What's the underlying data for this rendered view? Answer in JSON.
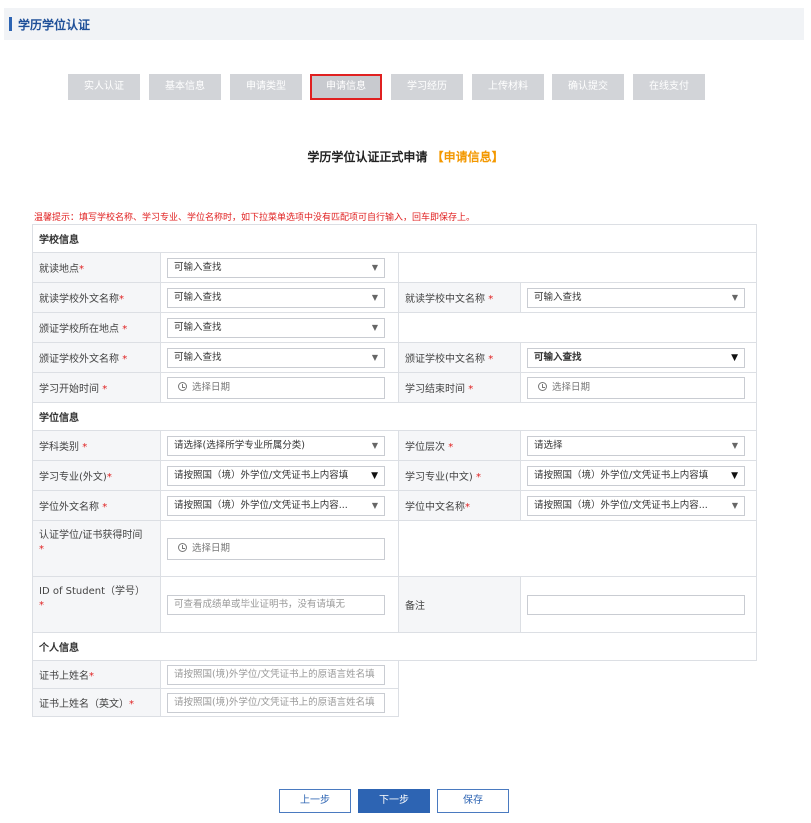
{
  "header": {
    "title": "学历学位认证"
  },
  "steps": [
    "实人认证",
    "基本信息",
    "申请类型",
    "申请信息",
    "学习经历",
    "上传材料",
    "确认提交",
    "在线支付"
  ],
  "form_title": {
    "main": "学历学位认证正式申请",
    "sub": "【申请信息】"
  },
  "tip": "温馨提示：填写学校名称、学习专业、学位名称时，如下拉菜单选项中没有匹配项可自行输入，回车即保存上。",
  "sections": {
    "school": "学校信息",
    "degree": "学位信息",
    "personal": "个人信息"
  },
  "fields": {
    "study_location": {
      "label": "就读地点",
      "value": "可输入查找"
    },
    "school_foreign": {
      "label": "就读学校外文名称",
      "value": "可输入查找"
    },
    "school_chinese": {
      "label": "就读学校中文名称 ",
      "value": "可输入查找"
    },
    "issuer_location": {
      "label": "颁证学校所在地点 ",
      "value": "可输入查找"
    },
    "issuer_foreign": {
      "label": "颁证学校外文名称 ",
      "value": "可输入查找"
    },
    "issuer_chinese": {
      "label": "颁证学校中文名称 ",
      "value": "可输入查找"
    },
    "study_start": {
      "label": "学习开始时间 ",
      "value": "选择日期"
    },
    "study_end": {
      "label": "学习结束时间 ",
      "value": "选择日期"
    },
    "subject_category": {
      "label": "学科类别 ",
      "value": "请选择(选择所学专业所属分类)"
    },
    "degree_level": {
      "label": "学位层次 ",
      "value": "请选择"
    },
    "major_foreign": {
      "label": "学习专业(外文)",
      "value": "请按照国（境）外学位/文凭证书上内容填"
    },
    "major_chinese": {
      "label": "学习专业(中文) ",
      "value": "请按照国（境）外学位/文凭证书上内容填"
    },
    "degree_foreign": {
      "label": "学位外文名称 ",
      "value": "请按照国（境）外学位/文凭证书上内容..."
    },
    "degree_chinese": {
      "label": "学位中文名称",
      "value": "请按照国（境）外学位/文凭证书上内容..."
    },
    "degree_obtained": {
      "label": "认证学位/证书获得时间",
      "value": "选择日期"
    },
    "student_id": {
      "label": "ID of Student（学号）",
      "placeholder": "可查看成绩单或毕业证明书，没有请填无"
    },
    "remarks": {
      "label": "备注",
      "placeholder": ""
    },
    "surname_cert": {
      "label": "证书上姓名",
      "placeholder": "请按照国(境)外学位/文凭证书上的原语言姓名填"
    },
    "surname_en": {
      "label": "证书上姓名（英文）",
      "placeholder": "请按照国(境)外学位/文凭证书上的原语言姓名填"
    }
  },
  "buttons": {
    "prev": "上一步",
    "next": "下一步",
    "save": "保存"
  },
  "colors": {
    "accent": "#2d64b3",
    "required": "#e02020",
    "highlight": "#f39800"
  }
}
